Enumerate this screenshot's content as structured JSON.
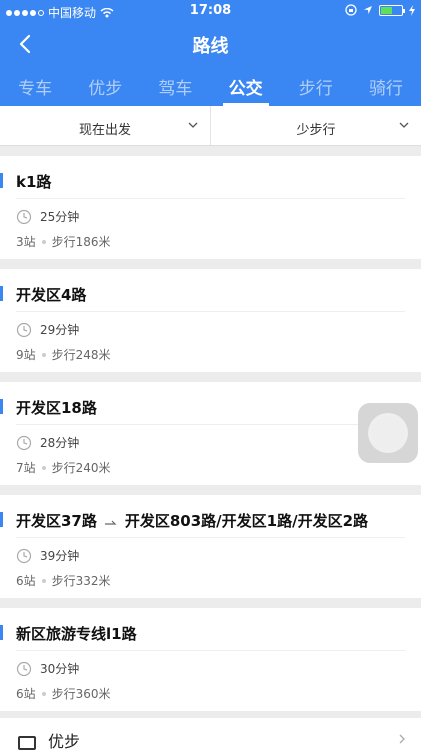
{
  "status": {
    "carrier": "中国移动",
    "time": "17:08"
  },
  "nav": {
    "title": "路线"
  },
  "tabs": [
    {
      "label": "专车"
    },
    {
      "label": "优步"
    },
    {
      "label": "驾车"
    },
    {
      "label": "公交"
    },
    {
      "label": "步行"
    },
    {
      "label": "骑行"
    }
  ],
  "filters": {
    "depart": "现在出发",
    "preference": "少步行"
  },
  "routes": [
    {
      "line": "k1路",
      "transfer": "",
      "duration": "25分钟",
      "stops": "3站",
      "walk": "步行186米"
    },
    {
      "line": "开发区4路",
      "transfer": "",
      "duration": "29分钟",
      "stops": "9站",
      "walk": "步行248米"
    },
    {
      "line": "开发区18路",
      "transfer": "",
      "duration": "28分钟",
      "stops": "7站",
      "walk": "步行240米"
    },
    {
      "line": "开发区37路",
      "transfer": "开发区803路/开发区1路/开发区2路",
      "duration": "39分钟",
      "stops": "6站",
      "walk": "步行332米"
    },
    {
      "line": "新区旅游专线l1路",
      "transfer": "",
      "duration": "30分钟",
      "stops": "6站",
      "walk": "步行360米"
    }
  ],
  "bottom": {
    "label": "优步"
  },
  "colors": {
    "primary": "#3a86f2"
  }
}
